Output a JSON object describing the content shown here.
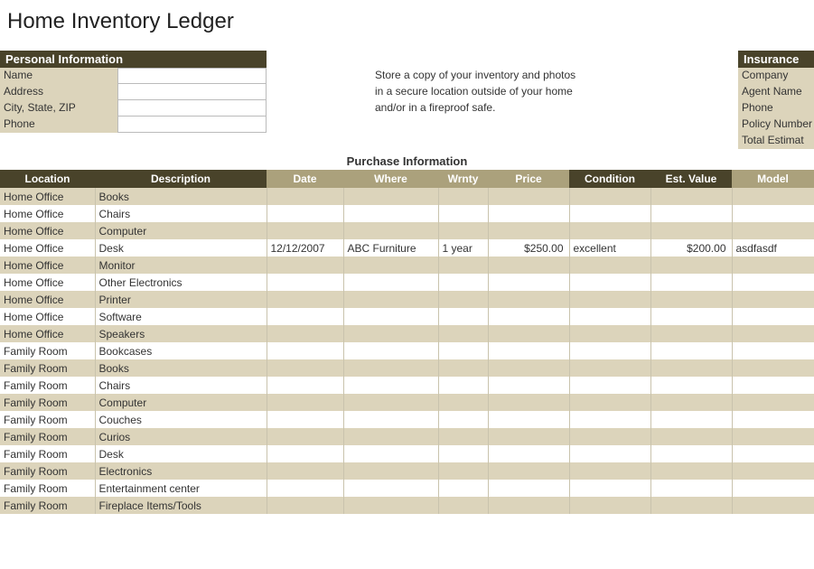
{
  "title": "Home Inventory Ledger",
  "personal": {
    "header": "Personal Information",
    "fields": [
      {
        "label": "Name",
        "value": ""
      },
      {
        "label": "Address",
        "value": ""
      },
      {
        "label": "City, State, ZIP",
        "value": ""
      },
      {
        "label": "Phone",
        "value": ""
      }
    ]
  },
  "store_text": {
    "l1": "Store a copy of your inventory and photos",
    "l2": "in a secure location outside of your home",
    "l3": "and/or in a fireproof safe."
  },
  "insurance": {
    "header": "Insurance",
    "fields": [
      "Company",
      "Agent Name",
      "Phone",
      "Policy Number",
      "Total Estimat"
    ]
  },
  "purchase_section_title": "Purchase Information",
  "columns": [
    {
      "key": "location",
      "label": "Location",
      "tone": "dark"
    },
    {
      "key": "description",
      "label": "Description",
      "tone": "dark"
    },
    {
      "key": "date",
      "label": "Date",
      "tone": "light"
    },
    {
      "key": "where",
      "label": "Where",
      "tone": "light"
    },
    {
      "key": "wrnty",
      "label": "Wrnty",
      "tone": "light"
    },
    {
      "key": "price",
      "label": "Price",
      "tone": "light"
    },
    {
      "key": "condition",
      "label": "Condition",
      "tone": "dark"
    },
    {
      "key": "est_value",
      "label": "Est. Value",
      "tone": "dark"
    },
    {
      "key": "model",
      "label": "Model",
      "tone": "light"
    }
  ],
  "rows": [
    {
      "location": "Home Office",
      "description": "Books"
    },
    {
      "location": "Home Office",
      "description": "Chairs"
    },
    {
      "location": "Home Office",
      "description": "Computer"
    },
    {
      "location": "Home Office",
      "description": "Desk",
      "date": "12/12/2007",
      "where": "ABC Furniture",
      "wrnty": "1 year",
      "price": "$250.00",
      "condition": "excellent",
      "est_value": "$200.00",
      "model": "asdfasdf"
    },
    {
      "location": "Home Office",
      "description": "Monitor"
    },
    {
      "location": "Home Office",
      "description": "Other Electronics"
    },
    {
      "location": "Home Office",
      "description": "Printer"
    },
    {
      "location": "Home Office",
      "description": "Software"
    },
    {
      "location": "Home Office",
      "description": "Speakers"
    },
    {
      "location": "Family Room",
      "description": "Bookcases"
    },
    {
      "location": "Family Room",
      "description": "Books"
    },
    {
      "location": "Family Room",
      "description": "Chairs"
    },
    {
      "location": "Family Room",
      "description": "Computer"
    },
    {
      "location": "Family Room",
      "description": "Couches"
    },
    {
      "location": "Family Room",
      "description": "Curios"
    },
    {
      "location": "Family Room",
      "description": "Desk"
    },
    {
      "location": "Family Room",
      "description": "Electronics"
    },
    {
      "location": "Family Room",
      "description": "Entertainment center"
    },
    {
      "location": "Family Room",
      "description": "Fireplace Items/Tools"
    }
  ]
}
